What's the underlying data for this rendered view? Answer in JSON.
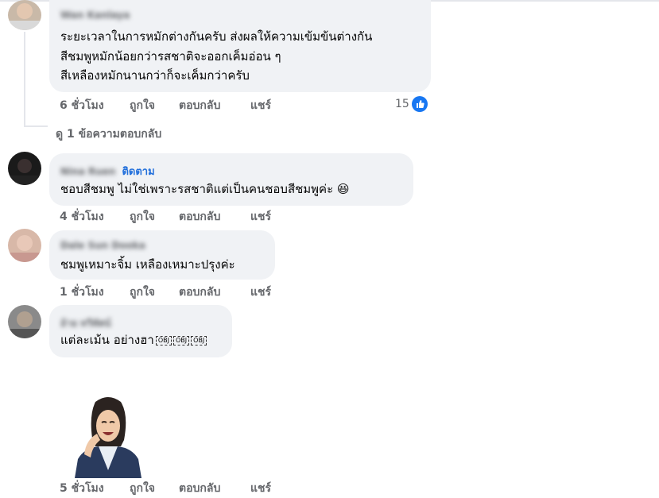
{
  "comments": [
    {
      "author": "Wan Kanlaya",
      "lines": [
        "ระยะเวลาในการหมักต่างกันครับ ส่งผลให้ความเข้มข้นต่างกัน",
        "สีชมพูหมักน้อยกว่ารสชาติจะออกเค็มอ่อน ๆ",
        "สีเหลืองหมักนานกว่าก็จะเค็มกว่าครับ"
      ],
      "time": "6 ชั่วโมง",
      "like": "ถูกใจ",
      "reply": "ตอบกลับ",
      "share": "แชร์",
      "reaction_count": "15",
      "reaction_icon": "like-icon"
    },
    {
      "author": "Nina Ruen",
      "follow": "ติดตาม",
      "lines": [
        "ชอบสีชมพู ไม่ใช่เพราะรสชาติแต่เป็นคนชอบสีชมพูค่ะ 😆"
      ],
      "time": "4 ชั่วโมง",
      "like": "ถูกใจ",
      "reply": "ตอบกลับ",
      "share": "แชร์"
    },
    {
      "author": "Dale Sun Dooka",
      "lines": [
        "ชมพูเหมาะจิ้ม เหลืองเหมาะปรุงค่ะ"
      ],
      "time": "1 ชั่วโมง",
      "like": "ถูกใจ",
      "reply": "ตอบกลับ",
      "share": "แชร์"
    },
    {
      "author": "อ้าย ทวีทัศน์",
      "lines": [
        "แต่ละเม้น อย่างฮา"
      ],
      "obj_tags": [
        "OBJ",
        "OBJ",
        "OBJ"
      ],
      "time": "5 ชั่วโมง",
      "like": "ถูกใจ",
      "reply": "ตอบกลับ",
      "share": "แชร์",
      "sticker": "laughing-man-sticker"
    }
  ],
  "view_replies": "ดู 1 ข้อความตอบกลับ"
}
